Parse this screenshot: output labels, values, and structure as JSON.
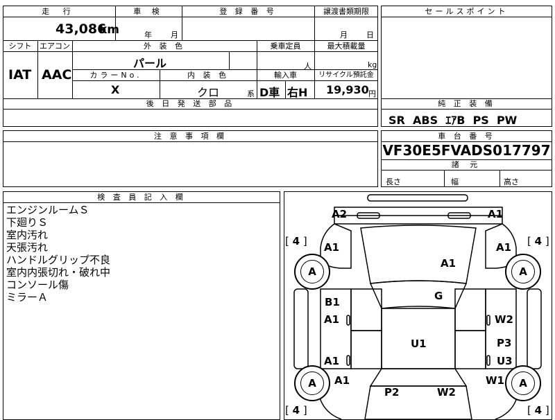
{
  "header": {
    "mileage_label": "走 行",
    "mileage_value": "43,086",
    "mileage_unit": "km",
    "inspection_label": "車 検",
    "inspection_year": "年",
    "inspection_month": "月",
    "registration_label": "登 録 番 号",
    "transfer_label": "譲渡書類期限",
    "transfer_month": "月",
    "transfer_day": "日"
  },
  "spec": {
    "shift_label": "シフト",
    "shift_value": "IAT",
    "aircon_label": "エアコン",
    "aircon_value": "AAC",
    "exterior_label": "外 装 色",
    "exterior_value": "パール",
    "capacity_label": "乗車定員",
    "capacity_unit": "人",
    "max_load_label": "最大積載量",
    "max_load_unit": "kg",
    "color_no_label": "カラーNo.",
    "color_no_value": "X",
    "interior_label": "内 装 色",
    "interior_value": "クロ",
    "interior_suffix": "系",
    "import_label": "輸入車",
    "import_d": "D車",
    "import_h": "右H",
    "recycle_label": "リサイクル預託金",
    "recycle_value": "19,930",
    "recycle_unit": "円",
    "later_parts_label": "後 日 発 送 部 品"
  },
  "sales": {
    "label": "セールスポイント",
    "equipment_label": "純 正 装 備",
    "equipment_value": "SR  ABS  ｴｱB  PS  PW"
  },
  "notes": {
    "label": "注 意 事 項 欄"
  },
  "chassis": {
    "label": "車 台 番 号",
    "value": "VF30E5FVADS017797",
    "dims_label": "諸 元",
    "length_label": "長さ",
    "width_label": "幅",
    "height_label": "高さ"
  },
  "inspector": {
    "label": "検 査 員 記 入 欄",
    "lines": [
      "エンジンルームＳ",
      "下廻りＳ",
      "室内汚れ",
      "天張汚れ",
      "ハンドルグリップ不良",
      "室内内張切れ・破れ中",
      "コンソール傷",
      "ミラーＡ"
    ]
  },
  "diagram": {
    "tire_count": "4",
    "labels": {
      "front_left_bumper": "A2",
      "front_right_bumper": "A1",
      "front_left_fender": "A1",
      "front_right_fender": "A1",
      "hood": "A1",
      "windshield": "G",
      "front_left_door_1": "B1",
      "front_left_door_2": "A1",
      "rear_left_door": "A1",
      "rear_left_quarter": "A1",
      "roof": "U1",
      "front_right_door": "W2",
      "rear_right_door_1": "P3",
      "rear_right_door_2": "U3",
      "rear_right_quarter": "W1",
      "rear_left_panel": "P2",
      "rear_right_panel": "W2",
      "wheel_fl": "A",
      "wheel_fr": "A",
      "wheel_rl": "A",
      "wheel_rr": "A"
    }
  }
}
